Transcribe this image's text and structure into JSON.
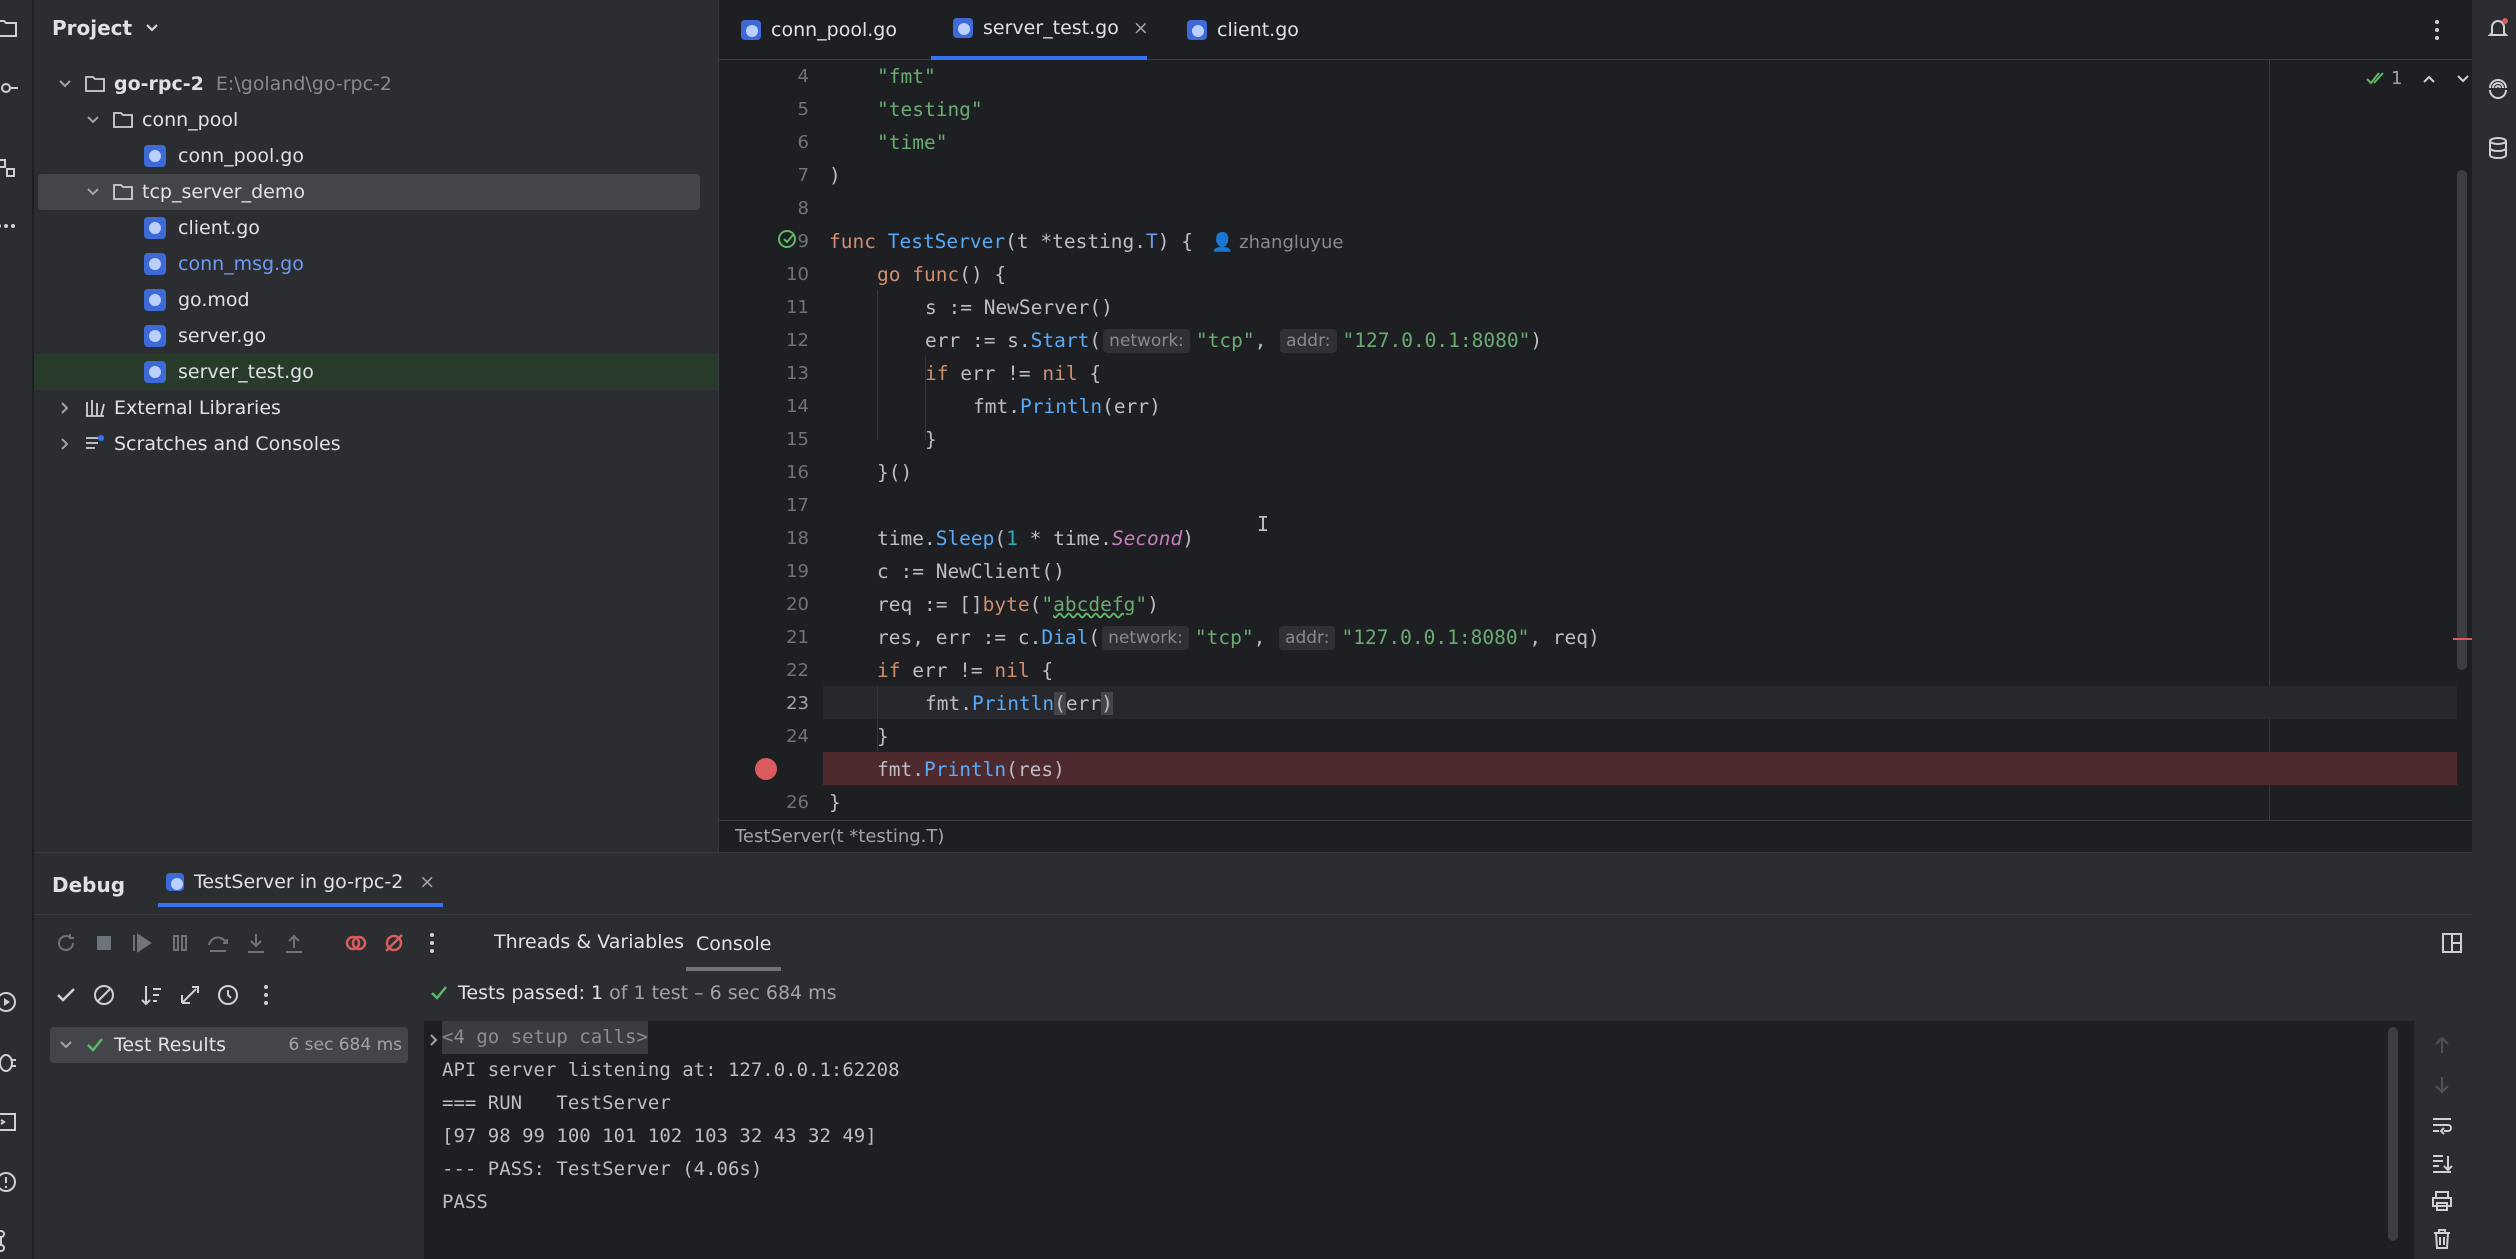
{
  "project": {
    "title": "Project",
    "tree": [
      {
        "label": "go-rpc-2",
        "path": "E:\\goland\\go-rpc-2",
        "level": 0,
        "type": "folder",
        "expanded": true
      },
      {
        "label": "conn_pool",
        "level": 1,
        "type": "folder",
        "expanded": true
      },
      {
        "label": "conn_pool.go",
        "level": 2,
        "type": "go"
      },
      {
        "label": "tcp_server_demo",
        "level": 1,
        "type": "folder",
        "expanded": true,
        "selected": true
      },
      {
        "label": "client.go",
        "level": 2,
        "type": "go"
      },
      {
        "label": "conn_msg.go",
        "level": 2,
        "type": "go",
        "modified": true
      },
      {
        "label": "go.mod",
        "level": 2,
        "type": "go"
      },
      {
        "label": "server.go",
        "level": 2,
        "type": "go"
      },
      {
        "label": "server_test.go",
        "level": 2,
        "type": "go",
        "active": true
      },
      {
        "label": "External Libraries",
        "level": 0,
        "type": "lib"
      },
      {
        "label": "Scratches and Consoles",
        "level": 0,
        "type": "scratch"
      }
    ]
  },
  "editor": {
    "tabs": [
      {
        "label": "conn_pool.go"
      },
      {
        "label": "server_test.go",
        "active": true,
        "close": "×"
      },
      {
        "label": "client.go"
      }
    ],
    "problems_count": "1",
    "current_line": 23,
    "breakpoint_line": 25,
    "breadcrumb": "TestServer(t *testing.T)",
    "author": "zhangluyue",
    "hints": {
      "network": "network:",
      "addr": "addr:"
    },
    "line_numbers": [
      "4",
      "5",
      "6",
      "7",
      "8",
      "9",
      "10",
      "11",
      "12",
      "13",
      "14",
      "15",
      "16",
      "17",
      "18",
      "19",
      "20",
      "21",
      "22",
      "23",
      "24",
      "",
      "26"
    ]
  },
  "debug": {
    "title": "Debug",
    "session_tab": "TestServer in go-rpc-2",
    "session_close": "×",
    "tabs": [
      "Threads & Variables",
      "Console"
    ],
    "active_tab": "Console",
    "tests_passed_label": "Tests passed:",
    "tests_passed_count": "1",
    "tests_passed_detail": "of 1 test – 6 sec 684 ms",
    "results_label": "Test Results",
    "results_time": "6 sec 684 ms",
    "console_lines": [
      "<4 go setup calls>",
      "API server listening at: 127.0.0.1:62208",
      "=== RUN   TestServer",
      "[97 98 99 100 101 102 103 32 43 32 49]",
      "--- PASS: TestServer (4.06s)",
      "PASS"
    ]
  },
  "colors": {
    "accent": "#3574f0",
    "breakpoint": "#db5c5c",
    "pass": "#5fb865",
    "keyword": "#cf8e6d",
    "string": "#6aab73",
    "function": "#56a8f5"
  }
}
